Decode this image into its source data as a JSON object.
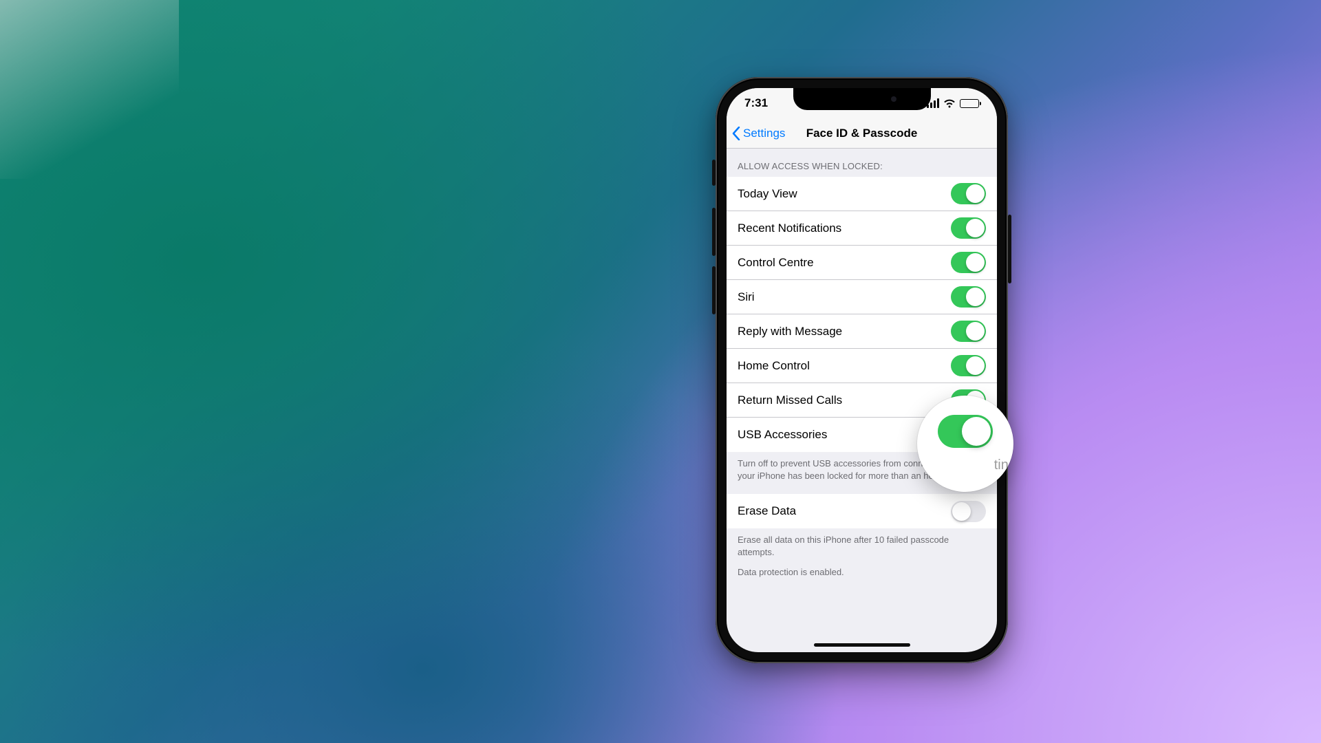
{
  "status": {
    "time": "7:31"
  },
  "nav": {
    "back_label": "Settings",
    "title": "Face ID & Passcode"
  },
  "section1": {
    "header": "ALLOW ACCESS WHEN LOCKED:",
    "rows": [
      {
        "label": "Today View",
        "on": true
      },
      {
        "label": "Recent Notifications",
        "on": true
      },
      {
        "label": "Control Centre",
        "on": true
      },
      {
        "label": "Siri",
        "on": true
      },
      {
        "label": "Reply with Message",
        "on": true
      },
      {
        "label": "Home Control",
        "on": true
      },
      {
        "label": "Return Missed Calls",
        "on": true
      },
      {
        "label": "USB Accessories",
        "on": true
      }
    ],
    "footer": "Turn off to prevent USB accessories from connecting when your iPhone has been locked for more than an hour."
  },
  "section2": {
    "rows": [
      {
        "label": "Erase Data",
        "on": false
      }
    ],
    "footer1": "Erase all data on this iPhone after 10 failed passcode attempts.",
    "footer2": "Data protection is enabled."
  },
  "magnifier": {
    "hint": "ting"
  }
}
